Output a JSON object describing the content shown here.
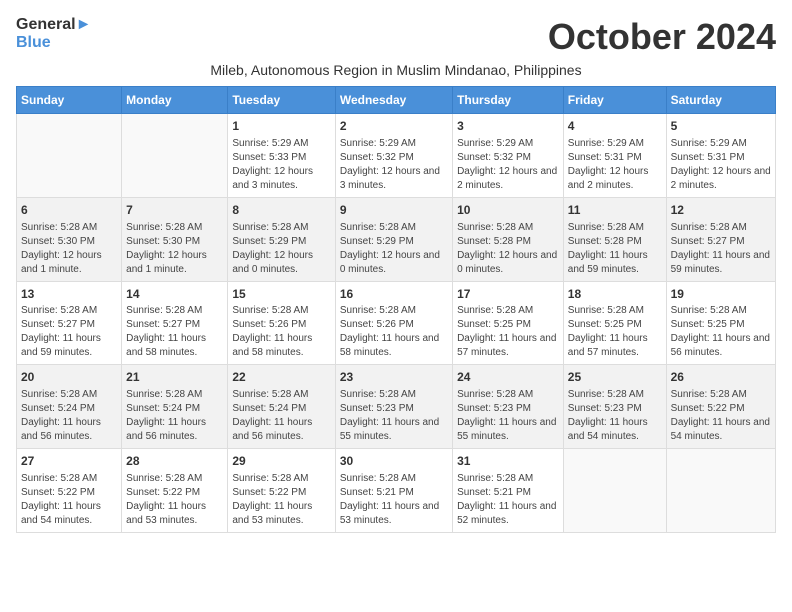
{
  "header": {
    "logo_general": "General",
    "logo_blue": "Blue",
    "month_title": "October 2024",
    "subtitle": "Mileb, Autonomous Region in Muslim Mindanao, Philippines"
  },
  "days_of_week": [
    "Sunday",
    "Monday",
    "Tuesday",
    "Wednesday",
    "Thursday",
    "Friday",
    "Saturday"
  ],
  "weeks": [
    [
      {
        "day": "",
        "info": ""
      },
      {
        "day": "",
        "info": ""
      },
      {
        "day": "1",
        "info": "Sunrise: 5:29 AM\nSunset: 5:33 PM\nDaylight: 12 hours and 3 minutes."
      },
      {
        "day": "2",
        "info": "Sunrise: 5:29 AM\nSunset: 5:32 PM\nDaylight: 12 hours and 3 minutes."
      },
      {
        "day": "3",
        "info": "Sunrise: 5:29 AM\nSunset: 5:32 PM\nDaylight: 12 hours and 2 minutes."
      },
      {
        "day": "4",
        "info": "Sunrise: 5:29 AM\nSunset: 5:31 PM\nDaylight: 12 hours and 2 minutes."
      },
      {
        "day": "5",
        "info": "Sunrise: 5:29 AM\nSunset: 5:31 PM\nDaylight: 12 hours and 2 minutes."
      }
    ],
    [
      {
        "day": "6",
        "info": "Sunrise: 5:28 AM\nSunset: 5:30 PM\nDaylight: 12 hours and 1 minute."
      },
      {
        "day": "7",
        "info": "Sunrise: 5:28 AM\nSunset: 5:30 PM\nDaylight: 12 hours and 1 minute."
      },
      {
        "day": "8",
        "info": "Sunrise: 5:28 AM\nSunset: 5:29 PM\nDaylight: 12 hours and 0 minutes."
      },
      {
        "day": "9",
        "info": "Sunrise: 5:28 AM\nSunset: 5:29 PM\nDaylight: 12 hours and 0 minutes."
      },
      {
        "day": "10",
        "info": "Sunrise: 5:28 AM\nSunset: 5:28 PM\nDaylight: 12 hours and 0 minutes."
      },
      {
        "day": "11",
        "info": "Sunrise: 5:28 AM\nSunset: 5:28 PM\nDaylight: 11 hours and 59 minutes."
      },
      {
        "day": "12",
        "info": "Sunrise: 5:28 AM\nSunset: 5:27 PM\nDaylight: 11 hours and 59 minutes."
      }
    ],
    [
      {
        "day": "13",
        "info": "Sunrise: 5:28 AM\nSunset: 5:27 PM\nDaylight: 11 hours and 59 minutes."
      },
      {
        "day": "14",
        "info": "Sunrise: 5:28 AM\nSunset: 5:27 PM\nDaylight: 11 hours and 58 minutes."
      },
      {
        "day": "15",
        "info": "Sunrise: 5:28 AM\nSunset: 5:26 PM\nDaylight: 11 hours and 58 minutes."
      },
      {
        "day": "16",
        "info": "Sunrise: 5:28 AM\nSunset: 5:26 PM\nDaylight: 11 hours and 58 minutes."
      },
      {
        "day": "17",
        "info": "Sunrise: 5:28 AM\nSunset: 5:25 PM\nDaylight: 11 hours and 57 minutes."
      },
      {
        "day": "18",
        "info": "Sunrise: 5:28 AM\nSunset: 5:25 PM\nDaylight: 11 hours and 57 minutes."
      },
      {
        "day": "19",
        "info": "Sunrise: 5:28 AM\nSunset: 5:25 PM\nDaylight: 11 hours and 56 minutes."
      }
    ],
    [
      {
        "day": "20",
        "info": "Sunrise: 5:28 AM\nSunset: 5:24 PM\nDaylight: 11 hours and 56 minutes."
      },
      {
        "day": "21",
        "info": "Sunrise: 5:28 AM\nSunset: 5:24 PM\nDaylight: 11 hours and 56 minutes."
      },
      {
        "day": "22",
        "info": "Sunrise: 5:28 AM\nSunset: 5:24 PM\nDaylight: 11 hours and 56 minutes."
      },
      {
        "day": "23",
        "info": "Sunrise: 5:28 AM\nSunset: 5:23 PM\nDaylight: 11 hours and 55 minutes."
      },
      {
        "day": "24",
        "info": "Sunrise: 5:28 AM\nSunset: 5:23 PM\nDaylight: 11 hours and 55 minutes."
      },
      {
        "day": "25",
        "info": "Sunrise: 5:28 AM\nSunset: 5:23 PM\nDaylight: 11 hours and 54 minutes."
      },
      {
        "day": "26",
        "info": "Sunrise: 5:28 AM\nSunset: 5:22 PM\nDaylight: 11 hours and 54 minutes."
      }
    ],
    [
      {
        "day": "27",
        "info": "Sunrise: 5:28 AM\nSunset: 5:22 PM\nDaylight: 11 hours and 54 minutes."
      },
      {
        "day": "28",
        "info": "Sunrise: 5:28 AM\nSunset: 5:22 PM\nDaylight: 11 hours and 53 minutes."
      },
      {
        "day": "29",
        "info": "Sunrise: 5:28 AM\nSunset: 5:22 PM\nDaylight: 11 hours and 53 minutes."
      },
      {
        "day": "30",
        "info": "Sunrise: 5:28 AM\nSunset: 5:21 PM\nDaylight: 11 hours and 53 minutes."
      },
      {
        "day": "31",
        "info": "Sunrise: 5:28 AM\nSunset: 5:21 PM\nDaylight: 11 hours and 52 minutes."
      },
      {
        "day": "",
        "info": ""
      },
      {
        "day": "",
        "info": ""
      }
    ]
  ]
}
